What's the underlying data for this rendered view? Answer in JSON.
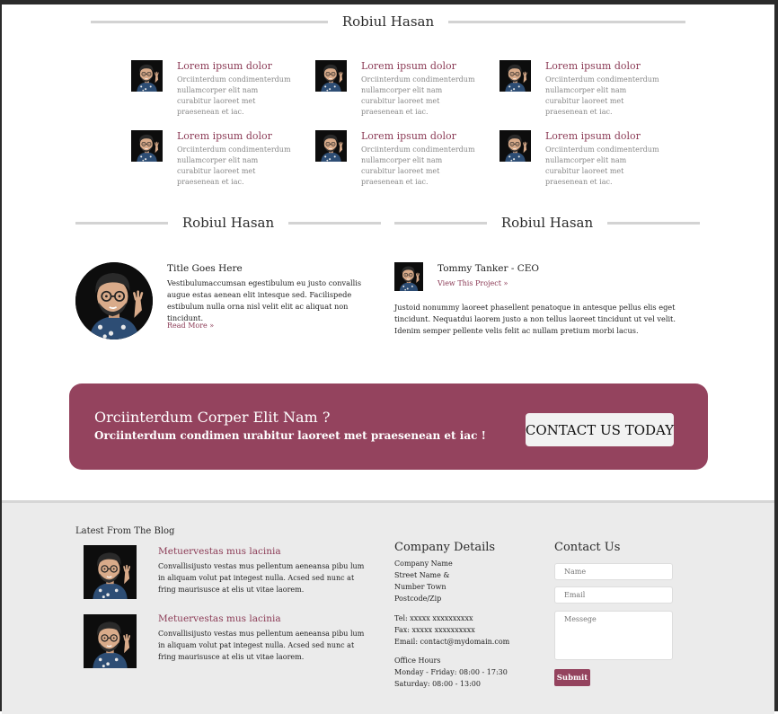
{
  "colors": {
    "accent": "#94435e",
    "footer_bg": "#ebebeb",
    "rule": "#d3d3d3"
  },
  "section1": {
    "heading": "Robiul Hasan",
    "items": [
      {
        "title": "Lorem ipsum dolor",
        "text": "Orciinterdum condimenterdum nullamcorper elit nam curabitur laoreet met praesenean et iac."
      },
      {
        "title": "Lorem ipsum dolor",
        "text": "Orciinterdum condimenterdum nullamcorper elit nam curabitur laoreet met praesenean et iac."
      },
      {
        "title": "Lorem ipsum dolor",
        "text": "Orciinterdum condimenterdum nullamcorper elit nam curabitur laoreet met praesenean et iac."
      },
      {
        "title": "Lorem ipsum dolor",
        "text": "Orciinterdum condimenterdum nullamcorper elit nam curabitur laoreet met praesenean et iac."
      },
      {
        "title": "Lorem ipsum dolor",
        "text": "Orciinterdum condimenterdum nullamcorper elit nam curabitur laoreet met praesenean et iac."
      },
      {
        "title": "Lorem ipsum dolor",
        "text": "Orciinterdum condimenterdum nullamcorper elit nam curabitur laoreet met praesenean et iac."
      }
    ]
  },
  "left_block": {
    "heading": "Robiul Hasan",
    "title": "Title Goes Here",
    "text": "Vestibulumaccumsan egestibulum eu justo convallis augue estas aenean elit intesque sed. Facilispede estibulum nulla orna nisl velit elit ac aliquat non tincidunt.",
    "read_more": "Read More »"
  },
  "right_block": {
    "heading": "Robiul Hasan",
    "name": "Tommy Tanker - CEO",
    "link": "View This Project »",
    "text": "Justoid nonummy laoreet phasellent penatoque in antesque pellus elis eget tincidunt. Nequatdui laorem justo a non tellus laoreet tincidunt ut vel velit. Idenim semper pellente velis felit ac nullam pretium morbi lacus."
  },
  "cta": {
    "heading": "Orciinterdum Corper Elit Nam ?",
    "subheading": "Orciinterdum condimen urabitur laoreet met praesenean et iac !",
    "button": "CONTACT US TODAY"
  },
  "footer": {
    "blog_heading": "Latest From The Blog",
    "posts": [
      {
        "title": "Metuervestas mus lacinia",
        "text": "Convallisijusto vestas mus pellentum aeneansa pibu lum in aliquam volut pat integest nulla. Acsed sed nunc at fring maurisusce at elis ut vitae laorem."
      },
      {
        "title": "Metuervestas mus lacinia",
        "text": "Convallisijusto vestas mus pellentum aeneansa pibu lum in aliquam volut pat integest nulla. Acsed sed nunc at fring maurisusce at elis ut vitae laorem."
      }
    ],
    "company_heading": "Company Details",
    "address": [
      "Company Name",
      "Street Name &",
      "Number Town",
      "Postcode/Zip"
    ],
    "contact_lines": [
      "Tel: xxxxx xxxxxxxxxx",
      "Fax: xxxxx xxxxxxxxxx",
      "Email: contact@mydomain.com"
    ],
    "hours": [
      "Office Hours",
      "Monday - Friday: 08:00 - 17:30",
      "Saturday: 08:00 - 13:00"
    ],
    "contact_heading": "Contact Us",
    "name_placeholder": "Name",
    "email_placeholder": "Email",
    "message_placeholder": "Messege",
    "submit": "Submit"
  }
}
